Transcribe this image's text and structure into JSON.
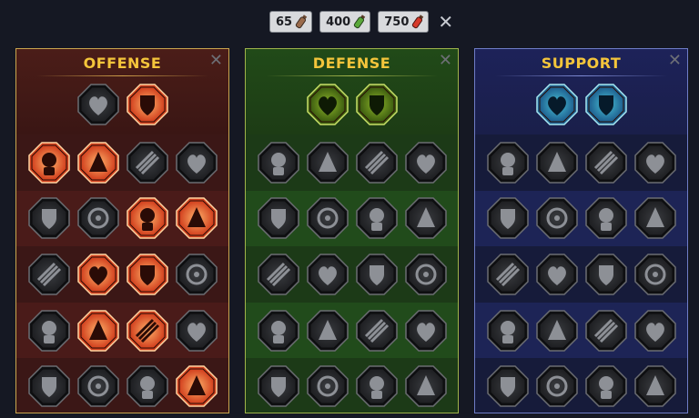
{
  "resources": [
    {
      "count": "65",
      "name": "small-vial-icon",
      "color": "#9b6b4c"
    },
    {
      "count": "400",
      "name": "green-vial-icon",
      "color": "#5aa83a"
    },
    {
      "count": "750",
      "name": "red-vial-icon",
      "color": "#d63a2a"
    }
  ],
  "close_symbol": "✕",
  "panels": [
    {
      "id": "offense",
      "title": "OFFENSE",
      "close": "✕",
      "head": [
        {
          "name": "crossed-swords-icon",
          "lit": false
        },
        {
          "name": "claw-slash-icon",
          "lit": true
        }
      ],
      "rows": [
        [
          {
            "name": "demon-head-icon",
            "lit": true
          },
          {
            "name": "blade-rain-icon",
            "lit": true
          },
          {
            "name": "shuriken-icon",
            "lit": false
          },
          {
            "name": "pierced-heart-icon",
            "lit": false
          }
        ],
        [
          {
            "name": "fist-strike-icon",
            "lit": false
          },
          {
            "name": "fanged-mouth-icon",
            "lit": false
          },
          {
            "name": "skull-slash-icon",
            "lit": true
          },
          {
            "name": "arm-strike-icon",
            "lit": true
          }
        ],
        [
          {
            "name": "dagger-heart-icon",
            "lit": false
          },
          {
            "name": "power-fist-icon",
            "lit": true
          },
          {
            "name": "axe-icon",
            "lit": true
          },
          {
            "name": "chained-bolt-icon",
            "lit": false
          }
        ],
        [
          {
            "name": "claw-burst-icon",
            "lit": false
          },
          {
            "name": "toxic-skull-icon",
            "lit": true
          },
          {
            "name": "arrow-dagger-icon",
            "lit": true
          },
          {
            "name": "brute-figure-icon",
            "lit": false
          }
        ],
        [
          {
            "name": "sword-spark-icon",
            "lit": false
          },
          {
            "name": "knight-helm-icon",
            "lit": false
          },
          {
            "name": "demon-figure-icon",
            "lit": false
          },
          {
            "name": "spartan-skull-icon",
            "lit": true
          }
        ]
      ]
    },
    {
      "id": "defense",
      "title": "DEFENSE",
      "close": "✕",
      "head": [
        {
          "name": "armor-plates-icon",
          "lit": true
        },
        {
          "name": "raised-fist-icon",
          "lit": true
        }
      ],
      "rows": [
        [
          {
            "name": "chevron-shield-icon",
            "lit": false
          },
          {
            "name": "heart-shard-icon",
            "lit": false
          },
          {
            "name": "muscle-figure-icon",
            "lit": false
          },
          {
            "name": "crossed-blades-icon",
            "lit": false
          }
        ],
        [
          {
            "name": "bow-figure-icon",
            "lit": false
          },
          {
            "name": "knight-shield-icon",
            "lit": false
          },
          {
            "name": "shield-heart-icon",
            "lit": false
          },
          {
            "name": "guarded-head-icon",
            "lit": false
          }
        ],
        [
          {
            "name": "fire-fist-icon",
            "lit": false
          },
          {
            "name": "hourglass-icon",
            "lit": false
          },
          {
            "name": "open-palm-icon",
            "lit": false
          },
          {
            "name": "bull-head-icon",
            "lit": false
          }
        ],
        [
          {
            "name": "dash-runner-icon",
            "lit": false
          },
          {
            "name": "spikes-icon",
            "lit": false
          },
          {
            "name": "radiant-skull-icon",
            "lit": false
          },
          {
            "name": "deflect-arc-icon",
            "lit": false
          }
        ],
        [
          {
            "name": "warrior-stance-icon",
            "lit": false
          },
          {
            "name": "crest-shield-icon",
            "lit": false
          },
          {
            "name": "bearded-head-icon",
            "lit": false
          },
          {
            "name": "flexing-figure-icon",
            "lit": false
          }
        ]
      ]
    },
    {
      "id": "support",
      "title": "SUPPORT",
      "close": "✕",
      "head": [
        {
          "name": "heart-sparkle-icon",
          "lit": true
        },
        {
          "name": "wind-rings-icon",
          "lit": true
        }
      ],
      "rows": [
        [
          {
            "name": "praying-hands-icon",
            "lit": false
          },
          {
            "name": "layered-shield-icon",
            "lit": false
          },
          {
            "name": "flame-skull-icon",
            "lit": false
          },
          {
            "name": "speed-hand-icon",
            "lit": false
          }
        ],
        [
          {
            "name": "sparkle-figure-icon",
            "lit": false
          },
          {
            "name": "lightning-shield-icon",
            "lit": false
          },
          {
            "name": "wave-icon",
            "lit": false
          },
          {
            "name": "twin-figures-icon",
            "lit": false
          }
        ],
        [
          {
            "name": "chain-heart-icon",
            "lit": false
          },
          {
            "name": "comet-icon",
            "lit": false
          },
          {
            "name": "open-book-icon",
            "lit": false
          },
          {
            "name": "sunburst-icon",
            "lit": false
          }
        ],
        [
          {
            "name": "compass-star-icon",
            "lit": false
          },
          {
            "name": "swift-boot-icon",
            "lit": false
          },
          {
            "name": "all-seeing-eye-icon",
            "lit": false
          },
          {
            "name": "leaping-figure-icon",
            "lit": false
          }
        ],
        [
          {
            "name": "potion-icon",
            "lit": false
          },
          {
            "name": "skull-icon",
            "lit": false
          },
          {
            "name": "hooded-heads-icon",
            "lit": false
          },
          {
            "name": "eagle-icon",
            "lit": false
          }
        ]
      ]
    }
  ]
}
